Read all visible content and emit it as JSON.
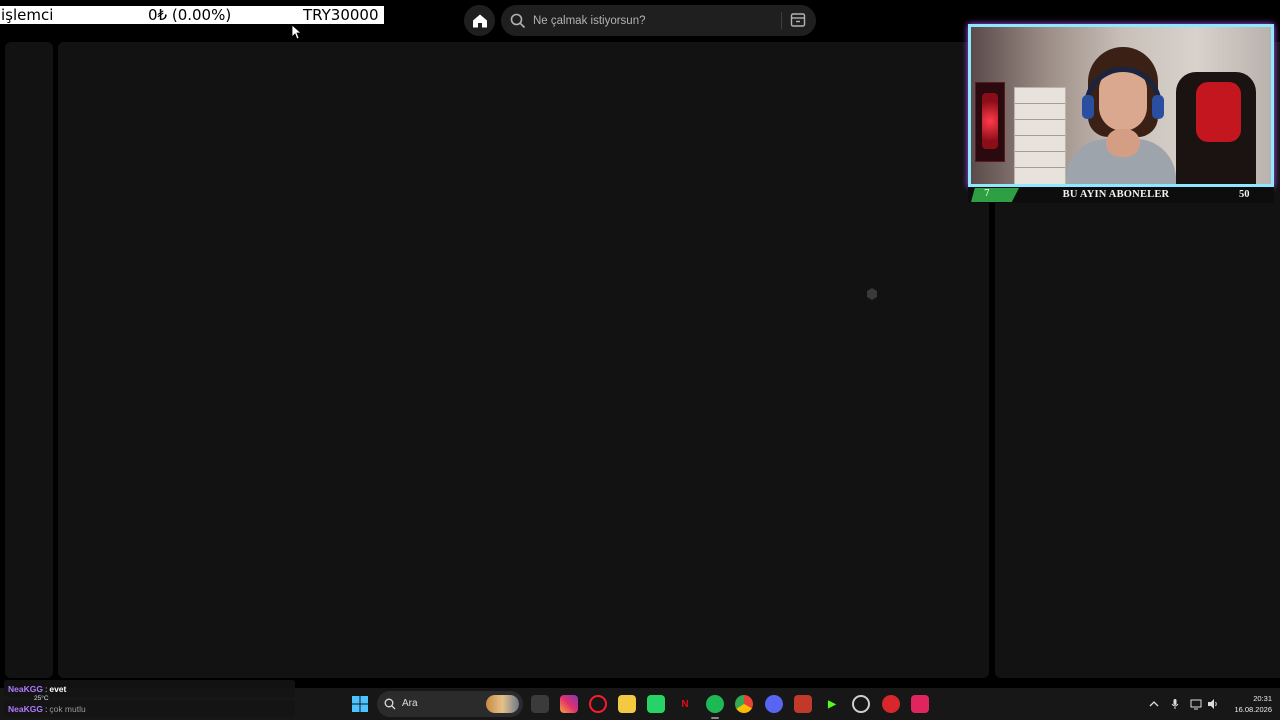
{
  "ticker": {
    "name": "işlemci",
    "change": "0₺ (0.00%)",
    "price": "TRY30000"
  },
  "search": {
    "placeholder": "Ne çalmak istiyorsun?"
  },
  "overlay": {
    "subs_left_count": "7",
    "subs_title": "BU AYIN ABONELER",
    "subs_right_count": "50"
  },
  "chat": [
    {
      "user": "NeaKGG",
      "sep": ":",
      "message": "evet"
    },
    {
      "user": "NeaKGG",
      "sep": ":",
      "message": "çok mutlu"
    }
  ],
  "weather": {
    "temp": "25°C"
  },
  "taskbar": {
    "search_label": "Ara",
    "time": "20:31",
    "date": "16.08.2026"
  },
  "colors": {
    "accent_green": "#1db954",
    "cam_border": "#8fe8ff",
    "cam_glow": "#b055ff",
    "chat_user": "#b07bff"
  }
}
